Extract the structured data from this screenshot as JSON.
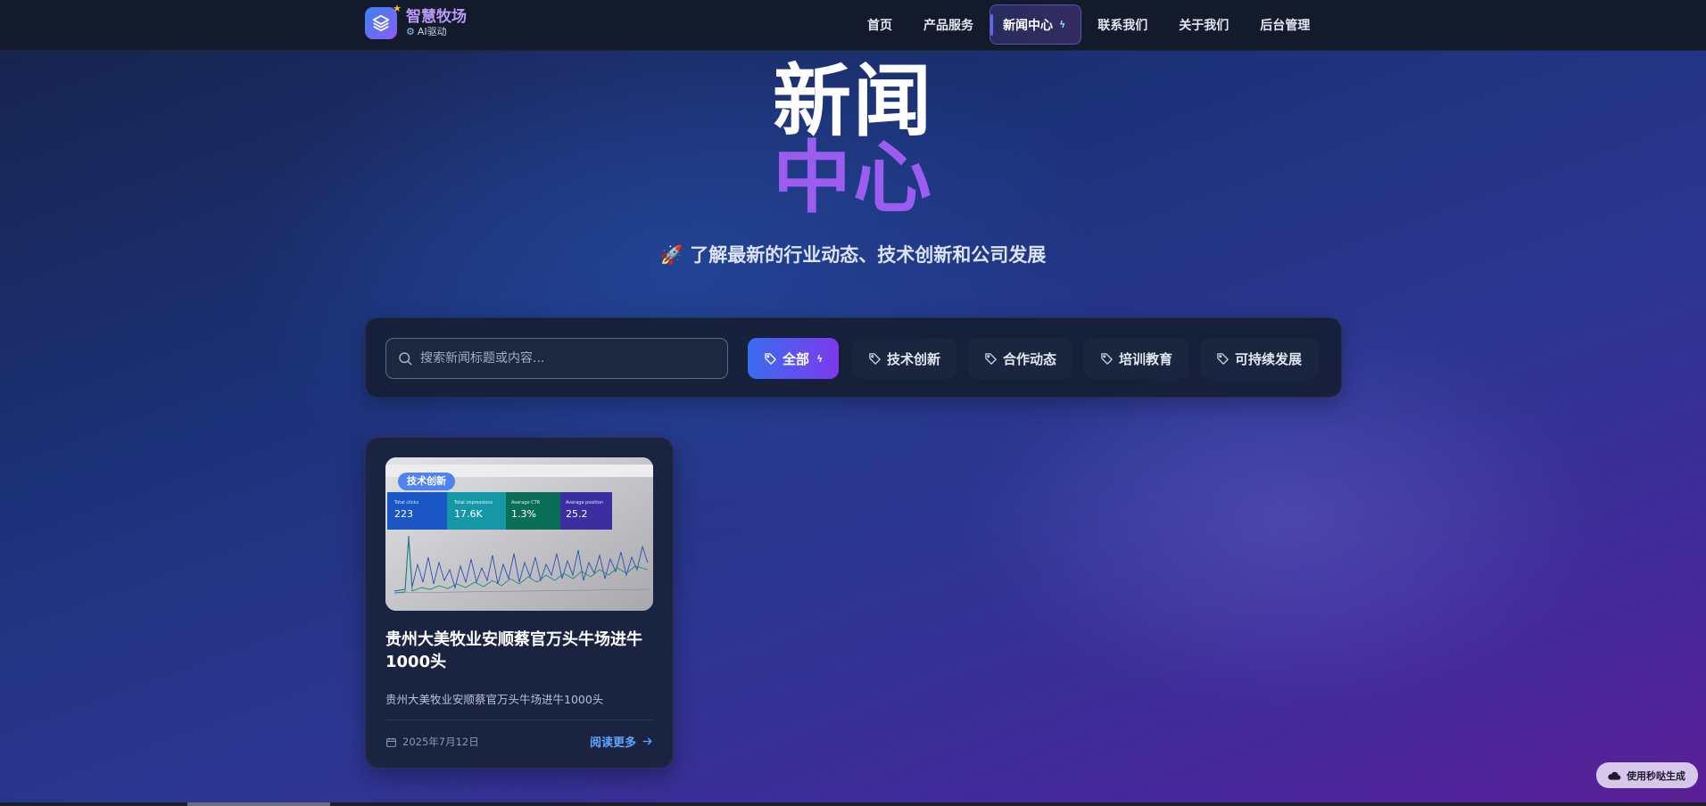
{
  "brand": {
    "name": "智慧牧场",
    "sub": "AI驱动"
  },
  "nav": {
    "items": [
      {
        "label": "首页"
      },
      {
        "label": "产品服务"
      },
      {
        "label": "新闻中心",
        "active": true
      },
      {
        "label": "联系我们"
      },
      {
        "label": "关于我们"
      },
      {
        "label": "后台管理"
      }
    ]
  },
  "hero": {
    "title_line1": "新闻",
    "title_line2": "中心",
    "subtitle": "🚀 了解最新的行业动态、技术创新和公司发展"
  },
  "search": {
    "placeholder": "搜索新闻标题或内容..."
  },
  "filters": [
    {
      "label": "全部",
      "active": true
    },
    {
      "label": "技术创新"
    },
    {
      "label": "合作动态"
    },
    {
      "label": "培训教育"
    },
    {
      "label": "可持续发展"
    }
  ],
  "articles": [
    {
      "category": "技术创新",
      "title": "贵州大美牧业安顺蔡官万头牛场进牛1000头",
      "summary": "贵州大美牧业安顺蔡官万头牛场进牛1000头",
      "date": "2025年7月12日",
      "read_more": "阅读更多",
      "image_metrics": [
        {
          "label": "Total clicks",
          "value": "223"
        },
        {
          "label": "Total impressions",
          "value": "17.6K"
        },
        {
          "label": "Average CTR",
          "value": "1.3%"
        },
        {
          "label": "Average position",
          "value": "25.2"
        }
      ]
    }
  ],
  "floating_badge": {
    "label": "使用秒哒生成"
  },
  "colors": {
    "accent_purple": "#9b5cf0",
    "accent_blue": "#3b6cf0",
    "link_blue": "#60a5fa",
    "nav_bg": "#131a2b",
    "card_bg": "#1a2440"
  }
}
